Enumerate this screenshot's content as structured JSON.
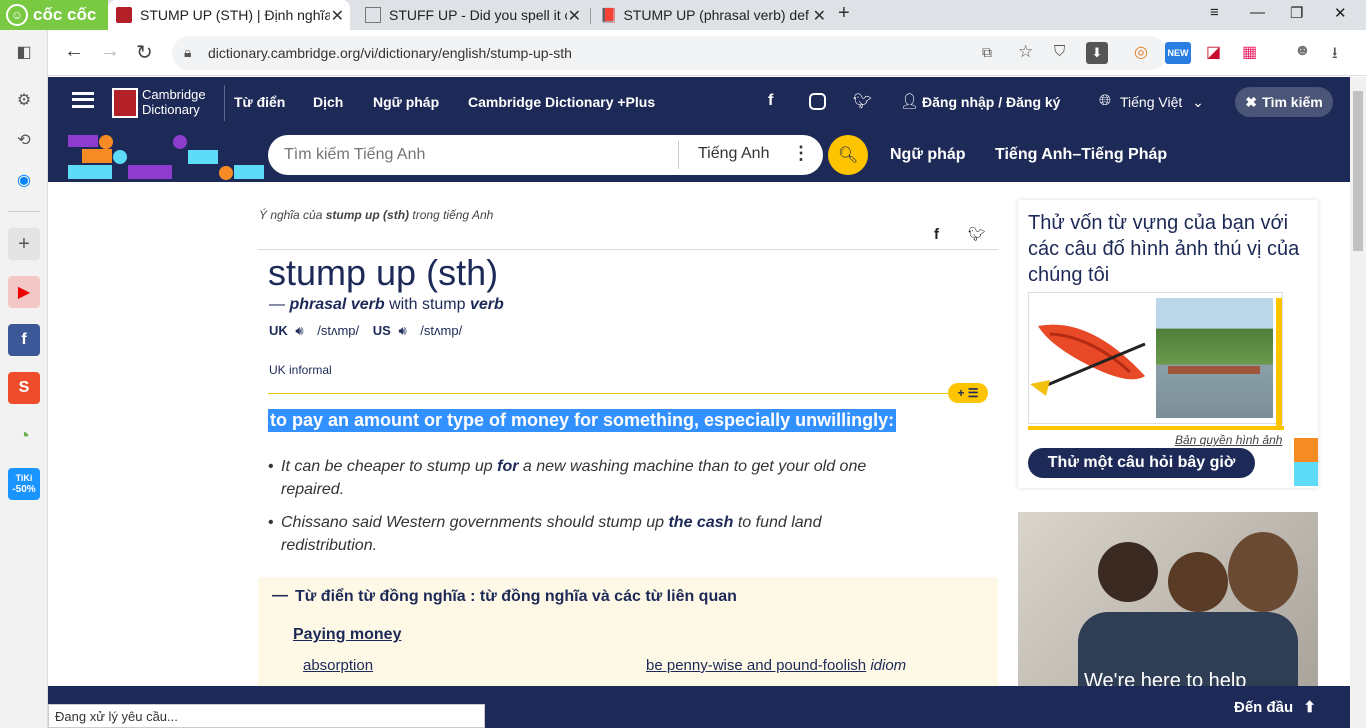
{
  "browser": {
    "brand": "cốc cốc",
    "tabs": [
      {
        "title": "STUMP UP (STH) | Định nghĩa",
        "active": true
      },
      {
        "title": "STUFF UP - Did you spell it co"
      },
      {
        "title": "STUMP UP (phrasal verb) defi"
      }
    ],
    "url": "dictionary.cambridge.org/vi/dictionary/english/stump-up-sth",
    "ext_badge": "NEW",
    "status": "Đang xử lý yêu cầu..."
  },
  "sidebar": {
    "tiki_label": "TiKi",
    "tiki_discount": "-50%"
  },
  "site": {
    "logo_line1": "Cambridge",
    "logo_line2": "Dictionary",
    "nav": [
      "Từ điển",
      "Dịch",
      "Ngữ pháp",
      "Cambridge Dictionary +Plus"
    ],
    "login": "Đăng nhập / Đăng ký",
    "language": "Tiếng Việt",
    "search_button": "Tìm kiếm",
    "search_placeholder": "Tìm kiếm Tiếng Anh",
    "search_lang": "Tiếng Anh",
    "quick_links": [
      "Ngữ pháp",
      "Tiếng Anh–Tiếng Pháp"
    ]
  },
  "entry": {
    "meaning_of_prefix": "Ý nghĩa của ",
    "meaning_of_word": "stump up (sth)",
    "meaning_of_suffix": " trong tiếng Anh",
    "headword": "stump up (sth)",
    "pos_dash": "—",
    "pos": "phrasal verb",
    "pos_with": "with stump",
    "pos_verb": "verb",
    "uk": "UK",
    "uk_ipa": "/stʌmp/",
    "us": "US",
    "us_ipa": "/stʌmp/",
    "register": "UK informal",
    "definition": "to pay an amount or type of money for something, especially unwillingly:",
    "examples": [
      {
        "pre": "It can be cheaper to stump up ",
        "bold": "for",
        "post": " a new washing machine than to get your old one repaired."
      },
      {
        "pre": "Chissano said Western governments should stump up ",
        "bold": "the cash",
        "post": " to fund land redistribution."
      }
    ],
    "thesaurus_title": "Từ điển từ đồng nghĩa : từ đồng nghĩa và các từ liên quan",
    "thesaurus_group": "Paying money",
    "thesaurus_items": [
      "absorption",
      "be penny-wise and pound-foolish"
    ],
    "thesaurus_idiom": "idiom"
  },
  "ad": {
    "quiz_text": "Thử vốn từ vựng của bạn với các câu đố hình ảnh thú vị của chúng tôi",
    "copyright": "Bản quyền hình ảnh",
    "quiz_button": "Thử một câu hỏi bây giờ",
    "banner_text": "We're here to help"
  },
  "bottom": {
    "back_to_top": "Đến đầu"
  }
}
